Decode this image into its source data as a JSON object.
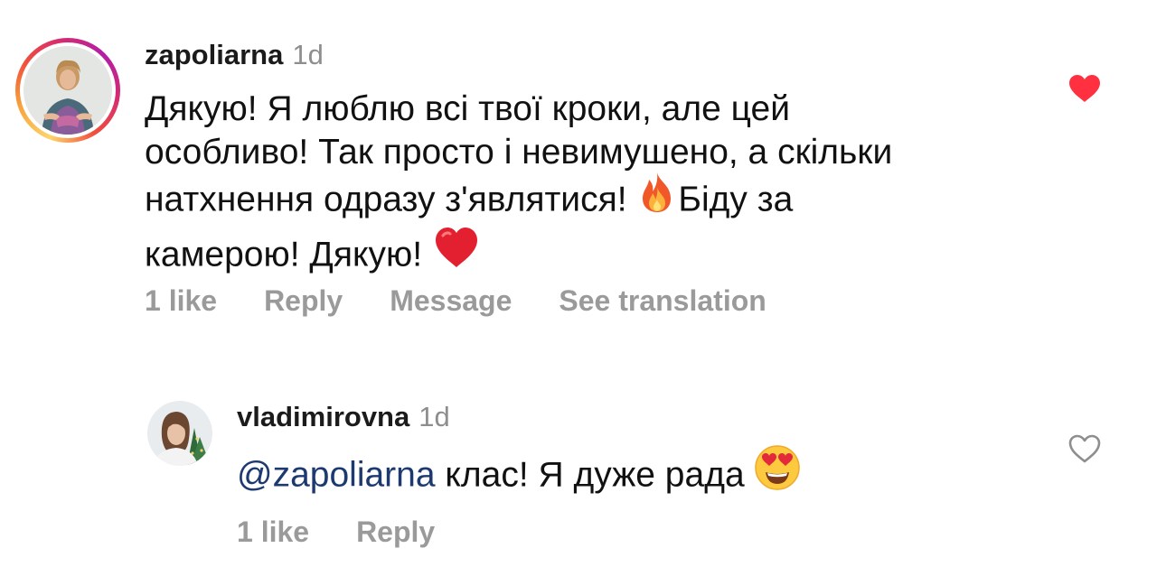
{
  "comments": [
    {
      "username": "zapoliarna",
      "time": "1d",
      "text_lines": [
        "Дякую! Я люблю всі твої кроки, але цей",
        "особливо! Так просто і невимушено, а скільки",
        "натхнення одразу з'являтися! ",
        "Біду за",
        "камерою! Дякую! "
      ],
      "likes": "1 like",
      "reply": "Reply",
      "message": "Message",
      "see_translation": "See translation",
      "liked": true
    },
    {
      "username": "vladimirovna",
      "time": "1d",
      "mention": "@zapoliarna",
      "text": " клас! Я дуже рада ",
      "likes": "1 like",
      "reply": "Reply",
      "liked": false
    }
  ],
  "icons": {
    "liked_heart": "heart-filled-icon",
    "like_heart": "heart-outline-icon",
    "fire_emoji": "fire-emoji-icon",
    "red_heart_emoji": "red-heart-emoji-icon",
    "heart_eyes_emoji": "heart-eyes-emoji-icon"
  },
  "colors": {
    "like_red": "#ff3040",
    "mention_blue": "#1d3a70",
    "secondary_text": "#8e8e8e"
  }
}
